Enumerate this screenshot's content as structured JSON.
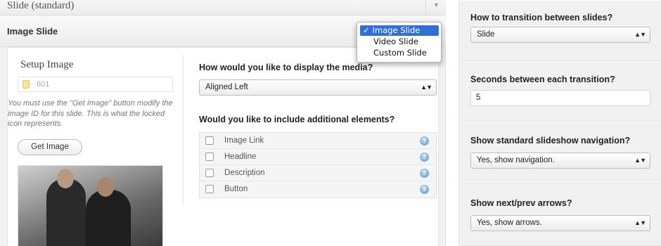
{
  "slide_bar": {
    "title": "Slide (standard)"
  },
  "header": {
    "title": "Image Slide"
  },
  "slide_type_dropdown": {
    "check": "✓",
    "options": [
      "Image Slide",
      "Video Slide",
      "Custom Slide"
    ],
    "selected_index": 0
  },
  "setup": {
    "title": "Setup Image",
    "image_id": "601",
    "help_text": "You must use the \"Get Image\" button modify the image ID for this slide. This is what the locked icon represents.",
    "button_label": "Get Image"
  },
  "media": {
    "question": "How would you like to display the media?",
    "selected": "Aligned Left"
  },
  "elements": {
    "question": "Would you like to include additional elements?",
    "items": [
      "Image Link",
      "Headline",
      "Description",
      "Button"
    ],
    "help_glyph": "?"
  },
  "settings": {
    "transition": {
      "question": "How to transition between slides?",
      "value": "Slide"
    },
    "seconds": {
      "question": "Seconds between each transition?",
      "value": "5"
    },
    "navigation": {
      "question": "Show standard slideshow navigation?",
      "value": "Yes, show navigation."
    },
    "arrows": {
      "question": "Show next/prev arrows?",
      "value": "Yes, show arrows."
    }
  },
  "glyphs": {
    "select_arrows": "▲▼",
    "collapse_arrow": "▼"
  },
  "colors": {
    "dropdown_highlight": "#2f6fd6",
    "help_icon": "#5d96c9"
  }
}
